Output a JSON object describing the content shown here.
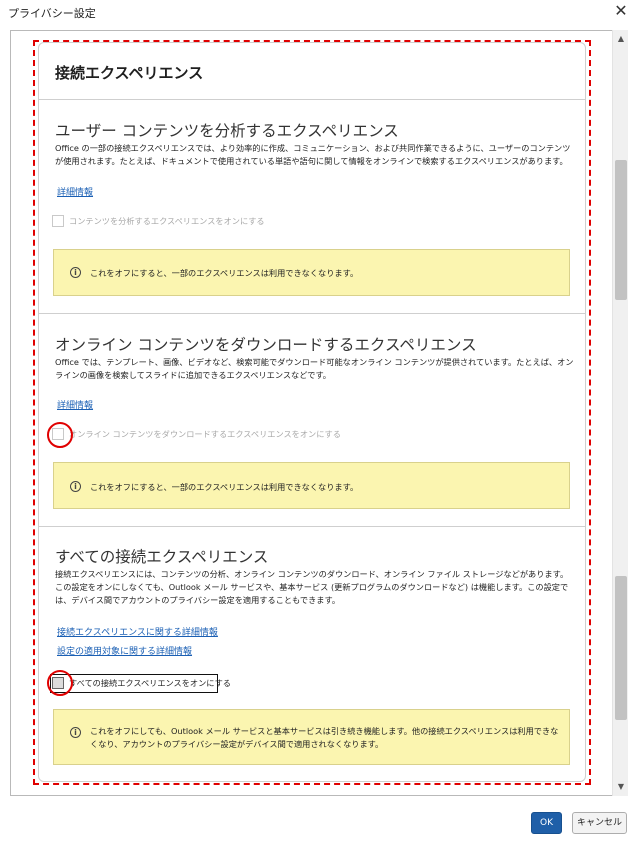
{
  "window": {
    "title": "プライバシー設定",
    "close_glyph": "✕"
  },
  "page": {
    "heading": "接続エクスペリエンス"
  },
  "sections": [
    {
      "title": "ユーザー コンテンツを分析するエクスペリエンス",
      "description": "Office の一部の接続エクスペリエンスでは、より効率的に作成、コミュニケーション、および共同作業できるように、ユーザーのコンテンツが使用されます。たとえば、ドキュメントで使用されている単語や語句に関して情報をオンラインで検索するエクスペリエンスがあります。",
      "link": "詳細情報",
      "checkbox_label": "コンテンツを分析するエクスペリエンスをオンにする",
      "checked": false,
      "info": "これをオフにすると、一部のエクスペリエンスは利用できなくなります。"
    },
    {
      "title": "オンライン コンテンツをダウンロードするエクスペリエンス",
      "description": "Office では、テンプレート、画像、ビデオなど、検索可能でダウンロード可能なオンライン コンテンツが提供されています。たとえば、オンラインの画像を検索してスライドに追加できるエクスペリエンスなどです。",
      "link": "詳細情報",
      "checkbox_label": "オンライン コンテンツをダウンロードするエクスペリエンスをオンにする",
      "checked": false,
      "info": "これをオフにすると、一部のエクスペリエンスは利用できなくなります。"
    },
    {
      "title": "すべての接続エクスペリエンス",
      "description": "接続エクスペリエンスには、コンテンツの分析、オンライン コンテンツのダウンロード、オンライン ファイル ストレージなどがあります。この設定をオンにしなくても、Outlook メール サービスや、基本サービス (更新プログラムのダウンロードなど) は機能します。この設定では、デバイス間でアカウントのプライバシー設定を適用することもできます。",
      "link1": "接続エクスペリエンスに関する詳細情報",
      "link2": "設定の適用対象に関する詳細情報",
      "checkbox_label": "すべての接続エクスペリエンスをオンにする",
      "checked": false,
      "info": "これをオフにしても、Outlook メール サービスと基本サービスは引き続き機能します。他の接続エクスペリエンスは利用できなくなり、アカウントのプライバシー設定がデバイス間で適用されなくなります。"
    }
  ],
  "buttons": {
    "ok": "OK",
    "cancel": "キャンセル"
  },
  "icons": {
    "info": "i",
    "scroll_up": "▲",
    "scroll_down": "▼"
  },
  "colors": {
    "annotation": "#e00000",
    "info_bg": "#fbf5b0",
    "link": "#1a5fb4",
    "primary_button": "#1f5fa8"
  }
}
